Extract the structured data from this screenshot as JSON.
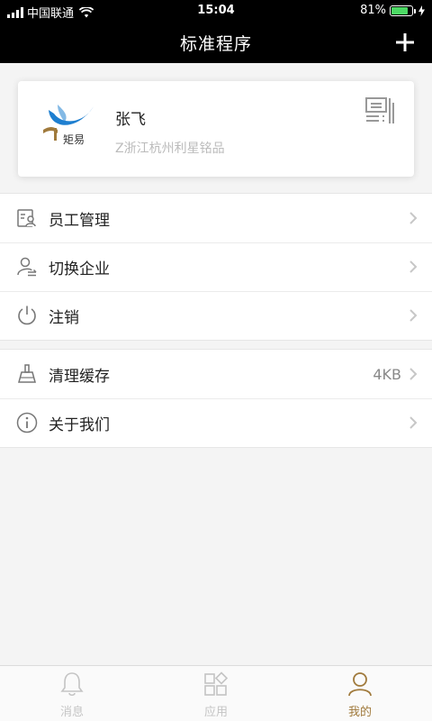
{
  "status_bar": {
    "carrier": "中国联通",
    "time": "15:04",
    "battery_percent": "81%",
    "battery_level": 0.81
  },
  "nav": {
    "title": "标准程序"
  },
  "profile": {
    "logo_text": "矩易",
    "name": "张飞",
    "company": "Z浙江杭州利星铭品"
  },
  "menu_group_1": [
    {
      "label": "员工管理",
      "icon": "staff-management-icon"
    },
    {
      "label": "切换企业",
      "icon": "switch-company-icon"
    },
    {
      "label": "注销",
      "icon": "power-icon"
    }
  ],
  "menu_group_2": [
    {
      "label": "清理缓存",
      "icon": "broom-icon",
      "value": "4KB"
    },
    {
      "label": "关于我们",
      "icon": "info-icon"
    }
  ],
  "tabs": [
    {
      "label": "消息",
      "icon": "bell-icon",
      "active": false
    },
    {
      "label": "应用",
      "icon": "apps-icon",
      "active": false
    },
    {
      "label": "我的",
      "icon": "user-icon",
      "active": true
    }
  ],
  "colors": {
    "header_bg": "#000000",
    "active_tab": "#a07a3c",
    "inactive_tab": "#c4c4c4",
    "battery_green": "#4cd964",
    "logo_blue": "#1e7fd0",
    "logo_gold": "#a07a3c"
  }
}
